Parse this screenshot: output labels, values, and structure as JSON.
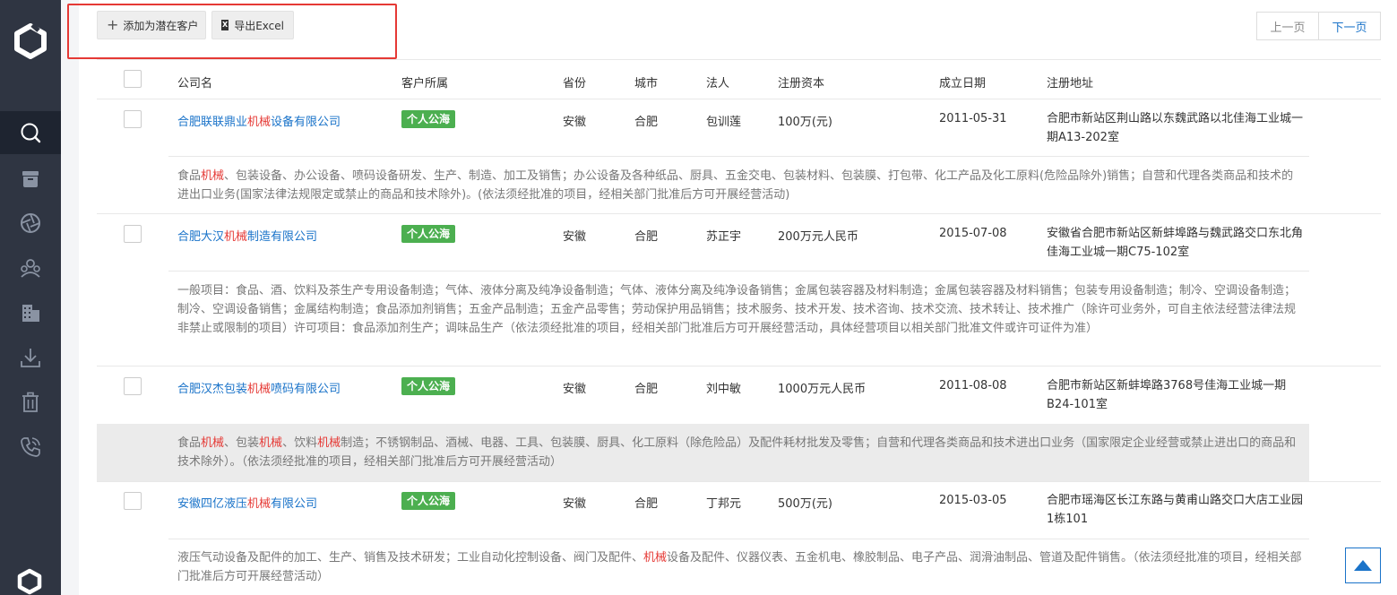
{
  "toolbar": {
    "add_label": "添加为潜在客户",
    "export_label": "导出Excel"
  },
  "pager": {
    "prev": "上一页",
    "next": "下一页"
  },
  "columns": [
    "公司名",
    "客户所属",
    "省份",
    "城市",
    "法人",
    "注册资本",
    "成立日期",
    "注册地址"
  ],
  "rows": [
    {
      "company": [
        "合肥联联鼎业",
        "机械",
        "设备有限公司"
      ],
      "owner": "个人公海",
      "province": "安徽",
      "city": "合肥",
      "legal": "包训莲",
      "capital": "100万(元)",
      "date": "2011-05-31",
      "address": "合肥市新站区荆山路以东魏武路以北佳海工业城一期A13-202室",
      "desc": [
        "食品",
        "机械",
        "、包装设备、办公设备、喷码设备研发、生产、制造、加工及销售；办公设备及各种纸品、厨具、五金交电、包装材料、包装膜、打包带、化工产品及化工原料(危险品除外)销售；自营和代理各类商品和技术的进出口业务(国家法律法规限定或禁止的商品和技术除外)。(依法须经批准的项目，经相关部门批准后方可开展经营活动)"
      ]
    },
    {
      "company": [
        "合肥大汉",
        "机械",
        "制造有限公司"
      ],
      "owner": "个人公海",
      "province": "安徽",
      "city": "合肥",
      "legal": "苏正宇",
      "capital": "200万元人民币",
      "date": "2015-07-08",
      "address": "安徽省合肥市新站区新蚌埠路与魏武路交口东北角佳海工业城一期C75-102室",
      "desc": [
        "一般项目：食品、酒、饮料及茶生产专用设备制造；气体、液体分离及纯净设备制造；气体、液体分离及纯净设备销售；金属包装容器及材料制造；金属包装容器及材料销售；包装专用设备制造；制冷、空调设备制造；制冷、空调设备销售；金属结构制造；食品添加剂销售；五金产品制造；五金产品零售；劳动保护用品销售；技术服务、技术开发、技术咨询、技术交流、技术转让、技术推广（除许可业务外，可自主依法经营法律法规非禁止或限制的项目）许可项目：食品添加剂生产；调味品生产（依法须经批准的项目，经相关部门批准后方可开展经营活动，具体经营项目以相关部门批准文件或许可证件为准）"
      ]
    },
    {
      "company": [
        "合肥汉杰包装",
        "机械",
        "喷码有限公司"
      ],
      "owner": "个人公海",
      "province": "安徽",
      "city": "合肥",
      "legal": "刘中敏",
      "capital": "1000万元人民币",
      "date": "2011-08-08",
      "address": "合肥市新站区新蚌埠路3768号佳海工业城一期B24-101室",
      "desc": [
        "食品",
        "机械",
        "、包装",
        "机械",
        "、饮料",
        "机械",
        "制造；不锈钢制品、酒械、电器、工具、包装膜、厨具、化工原料（除危险品）及配件耗材批发及零售；自营和代理各类商品和技术进出口业务（国家限定企业经营或禁止进出口的商品和技术除外）。（依法须经批准的项目，经相关部门批准后方可开展经营活动）"
      ]
    },
    {
      "company": [
        "安徽四亿液压",
        "机械",
        "有限公司"
      ],
      "owner": "个人公海",
      "province": "安徽",
      "city": "合肥",
      "legal": "丁邦元",
      "capital": "500万(元)",
      "date": "2015-03-05",
      "address": "合肥市瑶海区长江东路与黄甫山路交口大店工业园1栋101",
      "desc": [
        "液压气动设备及配件的加工、生产、销售及技术研发；工业自动化控制设备、阀门及配件、",
        "机械",
        "设备及配件、仪器仪表、五金机电、橡胶制品、电子产品、润滑油制品、管道及配件销售。（依法须经批准的项目，经相关部门批准后方可开展经营活动）"
      ]
    }
  ]
}
